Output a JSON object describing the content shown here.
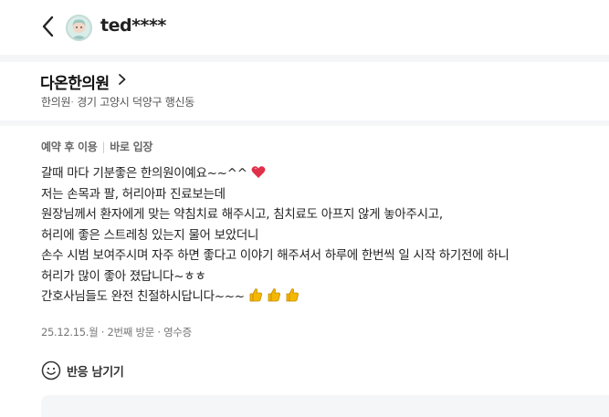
{
  "header": {
    "username": "ted****"
  },
  "place": {
    "name": "다온한의원",
    "category": "한의원",
    "separator": "·",
    "address": "경기 고양시 덕양구 행신동"
  },
  "review": {
    "tags": [
      "예약 후 이용",
      "바로 입장"
    ],
    "lines": [
      "갈때 마다 기분좋은 한의원이예요~~^^",
      "저는 손목과 팔, 허리아파 진료보는데",
      "원장님께서 환자에게 맞는 약침치료 해주시고, 침치료도 아프지 않게 놓아주시고,",
      "허리에 좋은 스트레칭 있는지 물어 보았더니",
      "손수 시범 보여주시며 자주 하면 좋다고 이야기 해주셔서 하루에 한번씩 일 시작 하기전에 하니",
      "허리가 많이 좋아 졌답니다~ㅎㅎ",
      "간호사님들도 완전 친절하시답니다~~~"
    ],
    "meta": "25.12.15.월 · 2번째 방문 · 영수증",
    "react_label": "반응 남기기"
  },
  "colors": {
    "heart": "#e0304a",
    "thumbs": "#f5b800",
    "gray_bg": "#f5f6f8"
  },
  "icons": {
    "back": "chevron-left-icon",
    "place_chevron": "chevron-right-icon",
    "heart": "heart-emoji-icon",
    "thumbs": "thumbs-up-emoji-icon",
    "react": "smile-icon"
  }
}
